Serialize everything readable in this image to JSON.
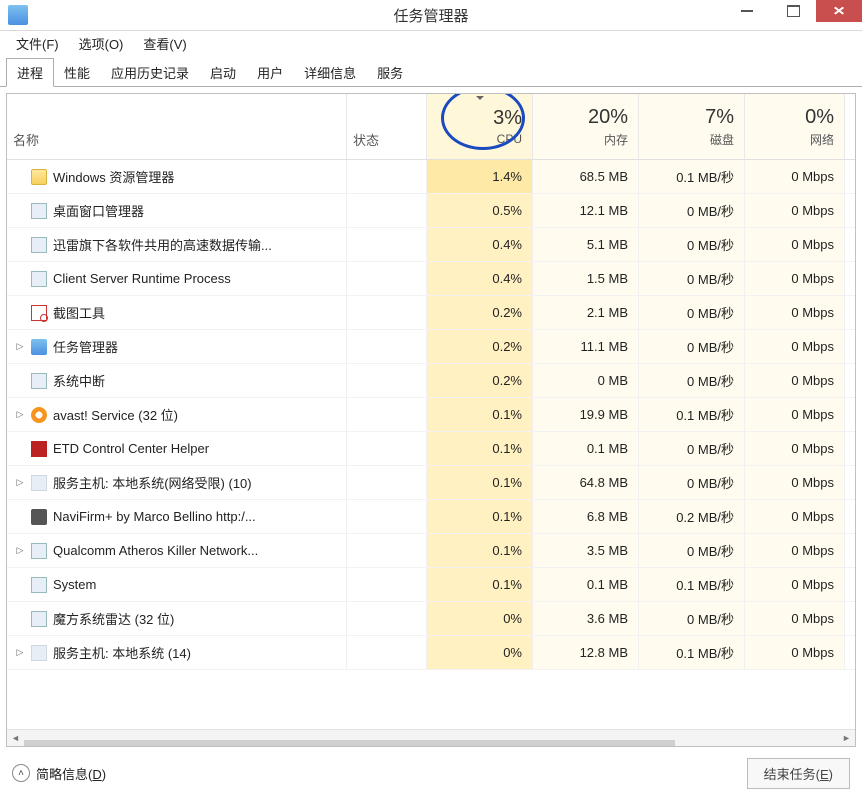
{
  "window": {
    "title": "任务管理器"
  },
  "menubar": [
    {
      "label": "文件(F)"
    },
    {
      "label": "选项(O)"
    },
    {
      "label": "查看(V)"
    }
  ],
  "tabs": [
    {
      "label": "进程",
      "active": true
    },
    {
      "label": "性能"
    },
    {
      "label": "应用历史记录"
    },
    {
      "label": "启动"
    },
    {
      "label": "用户"
    },
    {
      "label": "详细信息"
    },
    {
      "label": "服务"
    }
  ],
  "columns": {
    "name": "名称",
    "state": "状态",
    "cpu": {
      "value": "3%",
      "label": "CPU"
    },
    "mem": {
      "value": "20%",
      "label": "内存"
    },
    "disk": {
      "value": "7%",
      "label": "磁盘"
    },
    "net": {
      "value": "0%",
      "label": "网络"
    }
  },
  "rows": [
    {
      "icon": "folder",
      "expandable": false,
      "name": "Windows 资源管理器",
      "cpu": "1.4%",
      "mem": "68.5 MB",
      "disk": "0.1 MB/秒",
      "net": "0 Mbps"
    },
    {
      "icon": "app",
      "expandable": false,
      "name": "桌面窗口管理器",
      "cpu": "0.5%",
      "mem": "12.1 MB",
      "disk": "0 MB/秒",
      "net": "0 Mbps"
    },
    {
      "icon": "app",
      "expandable": false,
      "name": "迅雷旗下各软件共用的高速数据传输...",
      "cpu": "0.4%",
      "mem": "5.1 MB",
      "disk": "0 MB/秒",
      "net": "0 Mbps"
    },
    {
      "icon": "app",
      "expandable": false,
      "name": "Client Server Runtime Process",
      "cpu": "0.4%",
      "mem": "1.5 MB",
      "disk": "0 MB/秒",
      "net": "0 Mbps"
    },
    {
      "icon": "snip",
      "expandable": false,
      "name": "截图工具",
      "cpu": "0.2%",
      "mem": "2.1 MB",
      "disk": "0 MB/秒",
      "net": "0 Mbps"
    },
    {
      "icon": "tm",
      "expandable": true,
      "name": "任务管理器",
      "cpu": "0.2%",
      "mem": "11.1 MB",
      "disk": "0 MB/秒",
      "net": "0 Mbps"
    },
    {
      "icon": "app",
      "expandable": false,
      "name": "系统中断",
      "cpu": "0.2%",
      "mem": "0 MB",
      "disk": "0 MB/秒",
      "net": "0 Mbps"
    },
    {
      "icon": "avast",
      "expandable": true,
      "name": "avast! Service (32 位)",
      "cpu": "0.1%",
      "mem": "19.9 MB",
      "disk": "0.1 MB/秒",
      "net": "0 Mbps"
    },
    {
      "icon": "etd",
      "expandable": false,
      "name": "ETD Control Center Helper",
      "cpu": "0.1%",
      "mem": "0.1 MB",
      "disk": "0 MB/秒",
      "net": "0 Mbps"
    },
    {
      "icon": "svc",
      "expandable": true,
      "name": "服务主机: 本地系统(网络受限) (10)",
      "cpu": "0.1%",
      "mem": "64.8 MB",
      "disk": "0 MB/秒",
      "net": "0 Mbps"
    },
    {
      "icon": "navi",
      "expandable": false,
      "name": "NaviFirm+ by Marco Bellino http:/...",
      "cpu": "0.1%",
      "mem": "6.8 MB",
      "disk": "0.2 MB/秒",
      "net": "0 Mbps"
    },
    {
      "icon": "app",
      "expandable": true,
      "name": "Qualcomm Atheros Killer Network...",
      "cpu": "0.1%",
      "mem": "3.5 MB",
      "disk": "0 MB/秒",
      "net": "0 Mbps"
    },
    {
      "icon": "app",
      "expandable": false,
      "name": "System",
      "cpu": "0.1%",
      "mem": "0.1 MB",
      "disk": "0.1 MB/秒",
      "net": "0 Mbps"
    },
    {
      "icon": "app",
      "expandable": false,
      "name": "魔方系统雷达 (32 位)",
      "cpu": "0%",
      "mem": "3.6 MB",
      "disk": "0 MB/秒",
      "net": "0 Mbps"
    },
    {
      "icon": "svc",
      "expandable": true,
      "name": "服务主机: 本地系统 (14)",
      "cpu": "0%",
      "mem": "12.8 MB",
      "disk": "0.1 MB/秒",
      "net": "0 Mbps"
    }
  ],
  "bottom": {
    "lessmore": "简略信息(D)",
    "endtask": "结束任务(E)"
  }
}
